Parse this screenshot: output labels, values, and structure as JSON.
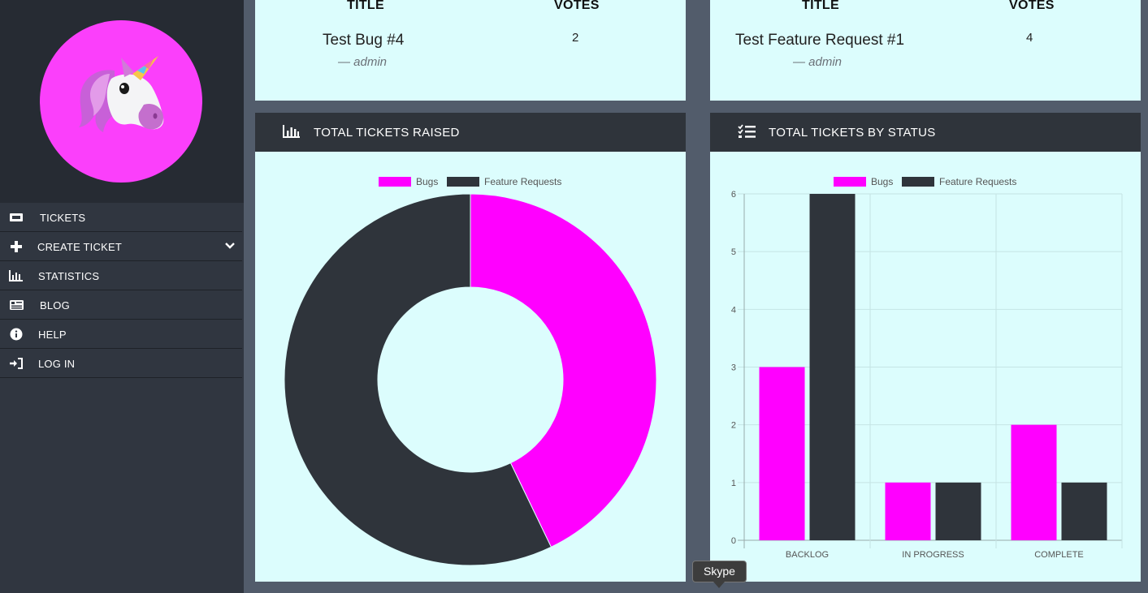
{
  "colors": {
    "bugs": "#ff00ff",
    "feature_requests": "#2f343b",
    "card_bg": "#dcfdfd",
    "sidebar_bg": "#303640",
    "avatar_bg": "#fb3ffb"
  },
  "sidebar": {
    "avatar_icon": "unicorn-icon",
    "items": [
      {
        "label": "TICKETS",
        "icon": "ticket-icon"
      },
      {
        "label": "CREATE TICKET",
        "icon": "plus-icon",
        "chevron": "chevron-down-icon"
      },
      {
        "label": "STATISTICS",
        "icon": "bar-chart-icon"
      },
      {
        "label": "BLOG",
        "icon": "newspaper-icon"
      },
      {
        "label": "HELP",
        "icon": "info-icon"
      },
      {
        "label": "LOG IN",
        "icon": "sign-in-icon"
      }
    ]
  },
  "top_bugs": {
    "col_title": "TITLE",
    "col_votes": "VOTES",
    "title": "Test Bug #4",
    "author": "— admin",
    "votes": "2"
  },
  "top_features": {
    "col_title": "TITLE",
    "col_votes": "VOTES",
    "title": "Test Feature Request #1",
    "author": "— admin",
    "votes": "4"
  },
  "donut_panel": {
    "title": "TOTAL TICKETS RAISED",
    "icon": "bar-chart-icon"
  },
  "bar_panel": {
    "title": "TOTAL TICKETS BY STATUS",
    "icon": "tasks-icon"
  },
  "chart_data": [
    {
      "type": "pie",
      "donut": true,
      "legend_position": "top",
      "labels": [
        "Bugs",
        "Feature Requests"
      ],
      "values": [
        6,
        8
      ]
    },
    {
      "type": "bar",
      "legend_position": "top",
      "categories": [
        "BACKLOG",
        "IN PROGRESS",
        "COMPLETE"
      ],
      "series": [
        {
          "name": "Bugs",
          "values": [
            3,
            1,
            2
          ]
        },
        {
          "name": "Feature Requests",
          "values": [
            6,
            1,
            1
          ]
        }
      ],
      "ylim": [
        0,
        6
      ],
      "yticks": [
        "0",
        "1",
        "2",
        "3",
        "4",
        "5",
        "6"
      ],
      "grid": true
    }
  ],
  "tooltip": {
    "text": "Skype"
  }
}
